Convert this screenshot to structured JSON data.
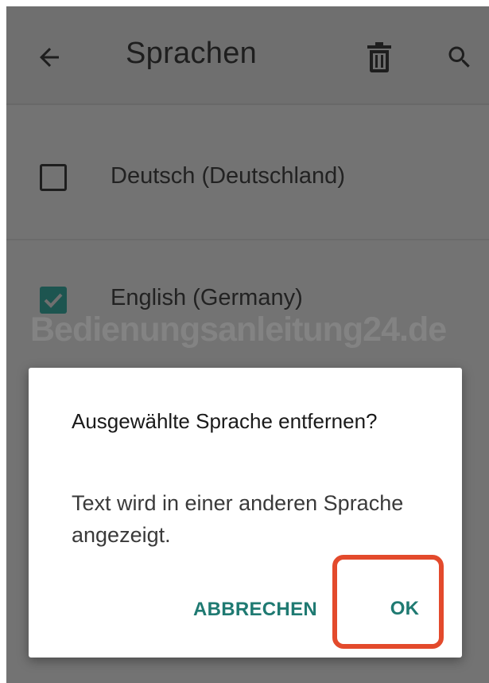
{
  "appbar": {
    "title": "Sprachen",
    "back_icon": "arrow-left-icon",
    "delete_icon": "trash-icon",
    "search_icon": "search-icon"
  },
  "languages": [
    {
      "label": "Deutsch (Deutschland)",
      "checked": false
    },
    {
      "label": "English (Germany)",
      "checked": true
    }
  ],
  "watermark": "Bedienungsanleitung24.de",
  "dialog": {
    "title": "Ausgewählte Sprache entfernen?",
    "message": "Text wird in einer anderen Sprache angezeigt.",
    "cancel_label": "ABBRECHEN",
    "ok_label": "OK"
  },
  "colors": {
    "accent": "#1f7a72",
    "highlight": "#e34a2c",
    "checkbox_checked": "#1d5550"
  }
}
